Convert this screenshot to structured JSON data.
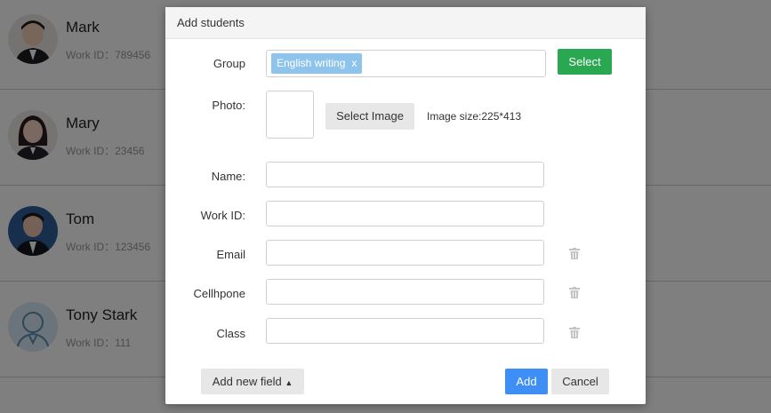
{
  "students": [
    {
      "name": "Mark",
      "work_id": "Work ID：789456"
    },
    {
      "name": "Mary",
      "work_id": "Work ID：23456"
    },
    {
      "name": "Tom",
      "work_id": "Work ID：123456"
    },
    {
      "name": "Tony Stark",
      "work_id": "Work ID：111"
    }
  ],
  "modal": {
    "title": "Add students",
    "group_label": "Group",
    "group_tag": "English writing",
    "group_tag_remove": "x",
    "select_label": "Select",
    "photo_label": "Photo:",
    "select_image_label": "Select Image",
    "image_size_text": "Image size:225*413",
    "fields": [
      {
        "label": "Name:",
        "value": "",
        "deletable": false
      },
      {
        "label": "Work ID:",
        "value": "",
        "deletable": false
      },
      {
        "label": "Email",
        "value": "",
        "deletable": true
      },
      {
        "label": "Cellhpone",
        "value": "",
        "deletable": true
      },
      {
        "label": "Class",
        "value": "",
        "deletable": true
      }
    ],
    "add_new_field_label": "Add new field",
    "add_label": "Add",
    "cancel_label": "Cancel"
  },
  "colors": {
    "select_button": "#2aa751",
    "add_button": "#3d8ef5",
    "tag": "#8ec4ec",
    "overlay": "rgba(0,0,0,0.5)"
  }
}
